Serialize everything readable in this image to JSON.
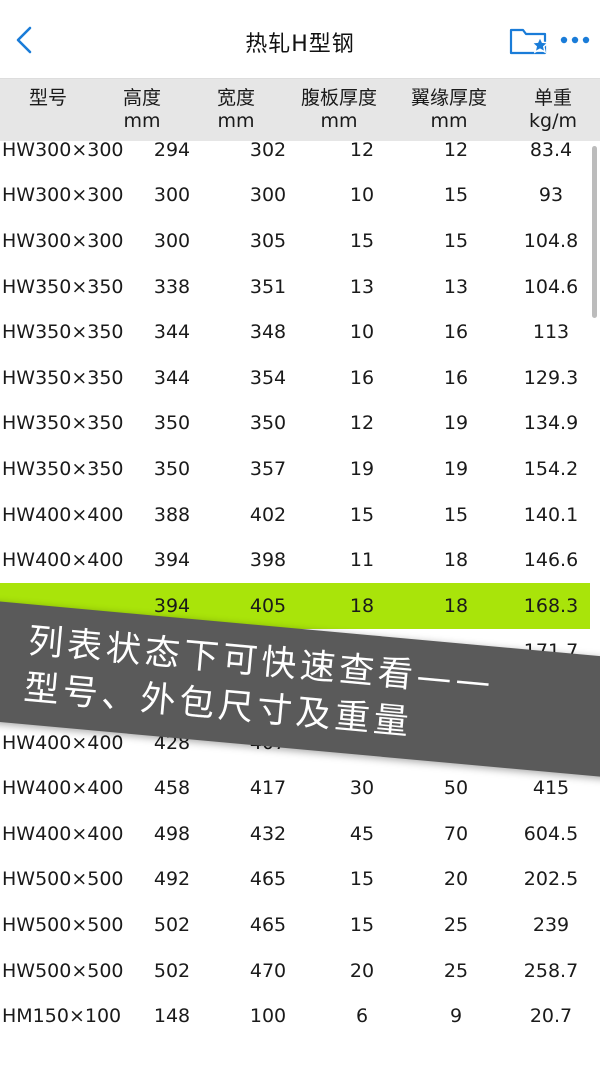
{
  "nav": {
    "title": "热轧H型钢",
    "back_icon": "chevron-left-icon",
    "folder_icon": "folder-star-icon",
    "more_icon": "more-dots-icon",
    "accent": "#1a7cd8"
  },
  "table": {
    "headers": [
      {
        "label": "型号",
        "unit": ""
      },
      {
        "label": "高度",
        "unit": "mm"
      },
      {
        "label": "宽度",
        "unit": "mm"
      },
      {
        "label": "腹板厚度",
        "unit": "mm"
      },
      {
        "label": "翼缘厚度",
        "unit": "mm"
      },
      {
        "label": "单重",
        "unit": "kg/m"
      }
    ],
    "highlight_color": "#a9e40a",
    "rows": [
      [
        "HW300×300",
        "294",
        "302",
        "12",
        "12",
        "83.4"
      ],
      [
        "HW300×300",
        "300",
        "300",
        "10",
        "15",
        "93"
      ],
      [
        "HW300×300",
        "300",
        "305",
        "15",
        "15",
        "104.8"
      ],
      [
        "HW350×350",
        "338",
        "351",
        "13",
        "13",
        "104.6"
      ],
      [
        "HW350×350",
        "344",
        "348",
        "10",
        "16",
        "113"
      ],
      [
        "HW350×350",
        "344",
        "354",
        "16",
        "16",
        "129.3"
      ],
      [
        "HW350×350",
        "350",
        "350",
        "12",
        "19",
        "134.9"
      ],
      [
        "HW350×350",
        "350",
        "357",
        "19",
        "19",
        "154.2"
      ],
      [
        "HW400×400",
        "388",
        "402",
        "15",
        "15",
        "140.1"
      ],
      [
        "HW400×400",
        "394",
        "398",
        "11",
        "18",
        "146.6"
      ],
      [
        "",
        "394",
        "405",
        "18",
        "18",
        "168.3"
      ],
      [
        "",
        "",
        "",
        "",
        "",
        "171.7"
      ],
      [
        "HW400×400",
        "",
        "",
        "",
        "",
        ""
      ],
      [
        "HW400×400",
        "428",
        "407",
        "20",
        "35",
        ""
      ],
      [
        "HW400×400",
        "458",
        "417",
        "30",
        "50",
        "415"
      ],
      [
        "HW400×400",
        "498",
        "432",
        "45",
        "70",
        "604.5"
      ],
      [
        "HW500×500",
        "492",
        "465",
        "15",
        "20",
        "202.5"
      ],
      [
        "HW500×500",
        "502",
        "465",
        "15",
        "25",
        "239"
      ],
      [
        "HW500×500",
        "502",
        "470",
        "20",
        "25",
        "258.7"
      ],
      [
        "HM150×100",
        "148",
        "100",
        "6",
        "9",
        "20.7"
      ]
    ]
  },
  "banner": {
    "line1": "列表状态下可快速查看——",
    "line2": "型号、外包尺寸及重量"
  }
}
